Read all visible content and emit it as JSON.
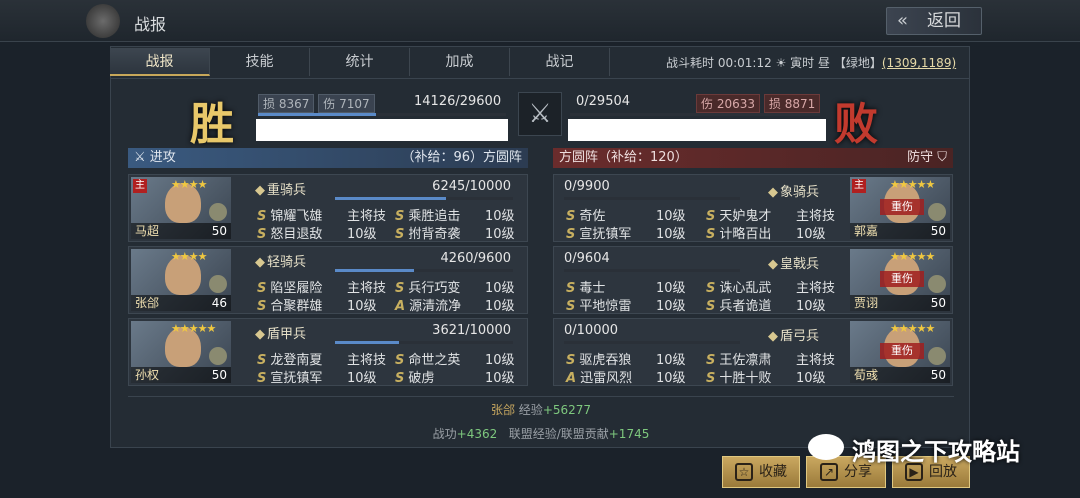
{
  "header": {
    "title": "战报",
    "back_label": "返回"
  },
  "tabs": [
    {
      "label": "战报"
    },
    {
      "label": "技能"
    },
    {
      "label": "统计"
    },
    {
      "label": "加成"
    },
    {
      "label": "战记"
    }
  ],
  "battle_info": {
    "duration_label": "战斗耗时",
    "duration": "00:01:12",
    "time": "寅时",
    "period": "昼",
    "terrain": "【绿地】",
    "coords": "(1309,1189)"
  },
  "result": {
    "win": "胜",
    "lose": "败"
  },
  "attacker": {
    "loss_label": "损",
    "loss": "8367",
    "hurt_label": "伤",
    "hurt": "7107",
    "troops": "14126/29600",
    "troops_frac": 0.477,
    "side_label": "进攻",
    "supply_text": "（补给：96）方圆阵"
  },
  "defender": {
    "loss_label": "损",
    "loss": "8871",
    "hurt_label": "伤",
    "hurt": "20633",
    "troops": "0/29504",
    "troops_frac": 0,
    "side_label": "防守",
    "supply_text": "方圆阵（补给：120）"
  },
  "att_cards": [
    {
      "name": "马超",
      "level": "50",
      "stars": "★★★★",
      "main": "主",
      "unit": "重骑兵",
      "troops": "6245/10000",
      "frac": 0.6245,
      "skills": [
        {
          "g": "S",
          "n": "锦耀飞雄",
          "v": "主将技"
        },
        {
          "g": "S",
          "n": "乘胜追击",
          "v": "10级"
        },
        {
          "g": "S",
          "n": "怒目退敌",
          "v": "10级"
        },
        {
          "g": "S",
          "n": "拊背奇袭",
          "v": "10级"
        }
      ]
    },
    {
      "name": "张郃",
      "level": "46",
      "stars": "★★★★",
      "main": "",
      "unit": "轻骑兵",
      "troops": "4260/9600",
      "frac": 0.444,
      "skills": [
        {
          "g": "S",
          "n": "陷坚履险",
          "v": "主将技"
        },
        {
          "g": "S",
          "n": "兵行巧变",
          "v": "10级"
        },
        {
          "g": "S",
          "n": "合聚群雄",
          "v": "10级"
        },
        {
          "g": "A",
          "n": "源清流净",
          "v": "10级"
        }
      ]
    },
    {
      "name": "孙权",
      "level": "50",
      "stars": "★★★★★",
      "main": "",
      "unit": "盾甲兵",
      "troops": "3621/10000",
      "frac": 0.3621,
      "skills": [
        {
          "g": "S",
          "n": "龙登南夏",
          "v": "主将技"
        },
        {
          "g": "S",
          "n": "命世之英",
          "v": "10级"
        },
        {
          "g": "S",
          "n": "宣抚镇军",
          "v": "10级"
        },
        {
          "g": "S",
          "n": "破虏",
          "v": "10级"
        }
      ]
    }
  ],
  "def_cards": [
    {
      "name": "郭嘉",
      "level": "50",
      "stars": "★★★★★",
      "main": "主",
      "hurt": "重伤",
      "unit": "象骑兵",
      "troops": "0/9900",
      "skills": [
        {
          "g": "S",
          "n": "奇佐",
          "v": "10级"
        },
        {
          "g": "S",
          "n": "天妒鬼才",
          "v": "主将技"
        },
        {
          "g": "S",
          "n": "宣抚镇军",
          "v": "10级"
        },
        {
          "g": "S",
          "n": "计略百出",
          "v": "10级"
        }
      ]
    },
    {
      "name": "贾诩",
      "level": "50",
      "stars": "★★★★★",
      "main": "",
      "hurt": "重伤",
      "unit": "皇戟兵",
      "troops": "0/9604",
      "skills": [
        {
          "g": "S",
          "n": "毒士",
          "v": "10级"
        },
        {
          "g": "S",
          "n": "诛心乱武",
          "v": "主将技"
        },
        {
          "g": "S",
          "n": "平地惊雷",
          "v": "10级"
        },
        {
          "g": "S",
          "n": "兵者诡道",
          "v": "10级"
        }
      ]
    },
    {
      "name": "荀彧",
      "level": "50",
      "stars": "★★★★★",
      "main": "",
      "hurt": "重伤",
      "unit": "盾弓兵",
      "troops": "0/10000",
      "skills": [
        {
          "g": "S",
          "n": "驱虎吞狼",
          "v": "10级"
        },
        {
          "g": "S",
          "n": "王佐凛肃",
          "v": "主将技"
        },
        {
          "g": "A",
          "n": "迅雷风烈",
          "v": "10级"
        },
        {
          "g": "S",
          "n": "十胜十败",
          "v": "10级"
        }
      ]
    }
  ],
  "footer": {
    "exp_name": "张郃",
    "exp_label": "经验",
    "exp_value": "+56277",
    "merit_label": "战功",
    "merit_value": "+4362",
    "alliance_label": "联盟经验/联盟贡献",
    "alliance_value": "+1745"
  },
  "buttons": {
    "collect": "收藏",
    "share": "分享",
    "replay": "回放"
  },
  "watermark": "鸿图之下攻略站"
}
